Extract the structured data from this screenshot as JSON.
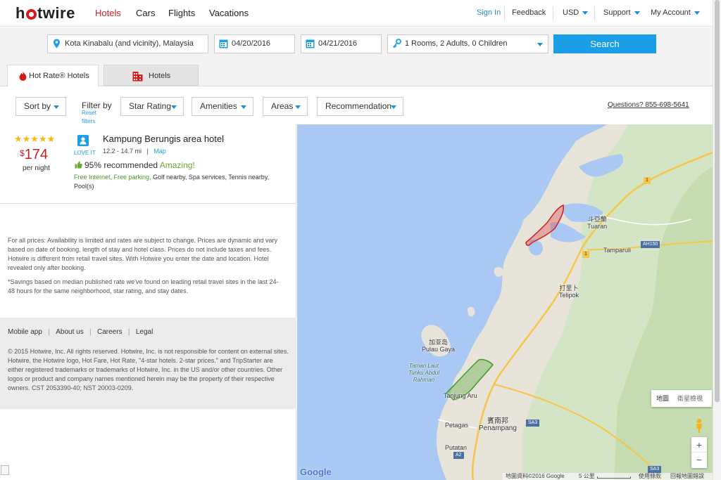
{
  "brand": {
    "logo": "hotwire"
  },
  "nav": {
    "hotels": "Hotels",
    "cars": "Cars",
    "flights": "Flights",
    "vacations": "Vacations",
    "signin": "Sign In",
    "feedback": "Feedback",
    "currency": "USD",
    "support": "Support",
    "account": "My Account"
  },
  "colors": {
    "accent": "#1a9ee8",
    "brand": "#d21c1c",
    "green": "#6aa82c"
  },
  "search": {
    "destination": "Kota Kinabalu (and vicinity), Malaysia",
    "checkin": "04/20/2016",
    "checkout": "04/21/2016",
    "guests": "1 Rooms, 2 Adults, 0 Children",
    "button": "Search"
  },
  "tabs": {
    "hot_rate": "Hot Rate® Hotels",
    "hotels": "Hotels"
  },
  "filters": {
    "sort": "Sort by",
    "filter_label": "Filter by",
    "reset": "Reset filters",
    "star": "Star Rating",
    "amenities": "Amenities",
    "areas": "Areas",
    "recommendation": "Recommendation",
    "questions": "Questions? 855-698-5641"
  },
  "result": {
    "stars": "★★★★★",
    "currency": "$",
    "price": "174",
    "per": "per night",
    "love": "LOVE IT",
    "name": "Kampung Berungis area hotel",
    "distance": "12.2 - 14.7 mi",
    "sep": "|",
    "map": "Map",
    "recommended": "95% recommended",
    "amazing": "Amazing!",
    "amen_free": "Free Internet, Free parking,",
    "amen_rest": " Golf nearby, Spa services, Tennis nearby, Pool(s)"
  },
  "disclaimer": {
    "p1": "For all prices: Availability is limited and rates are subject to change. Prices are dynamic and vary based on date of booking, length of stay and hotel class. Prices do not include taxes and fees. Hotwire is different from retail travel sites. With Hotwire you enter the date and location. Hotel revealed only after booking.",
    "p2": "*Savings based on median published rate we've found on leading retail travel sites in the last 24-48 hours for the same neighborhood, star rating, and stay dates."
  },
  "footer": {
    "mobile": "Mobile app",
    "about": "About us",
    "careers": "Careers",
    "legal": "Legal",
    "sep": "|",
    "copy": "© 2015 Hotwire, Inc. All rights reserved. Hotwire, Inc. is not responsible for content on external sites. Hotwire, the Hotwire logo, Hot Fare, Hot Rate, \"4-star hotels. 2-star prices.\" and TripStarter are either registered trademarks or trademarks of Hotwire, Inc. in the US and/or other countries. Other logos or product and company names mentioned herein may be the property of their respective owners. CST 2053390-40; NST 20003-0209."
  },
  "map": {
    "tuaran_cn": "斗亞蘭",
    "tuaran": "Tuaran",
    "tamparuli": "Tamparuli",
    "ah150": "AH150",
    "telipok_cn": "打里卜",
    "telipok": "Telipok",
    "gaya_cn": "加亚岛",
    "gaya": "Pulau Gaya",
    "park": "Taman Laut Tunku Abdul Rahman",
    "tanjung": "Tanjung Aru",
    "penampang_cn": "賓南邦",
    "penampang": "Penampang",
    "petagas": "Petagas",
    "putatan": "Putatan",
    "sa3": "SA3",
    "sa3b": "SA3",
    "a2": "A2",
    "r1": "1",
    "r1b": "1",
    "maptype": "地圖",
    "satellite": "衛星檢視",
    "zoom_in": "+",
    "zoom_out": "−",
    "google": "Google",
    "attribution": "地圖資料©2016 Google",
    "scale": "5 公里",
    "terms": "使用條款",
    "report": "回報地圖錯誤"
  }
}
